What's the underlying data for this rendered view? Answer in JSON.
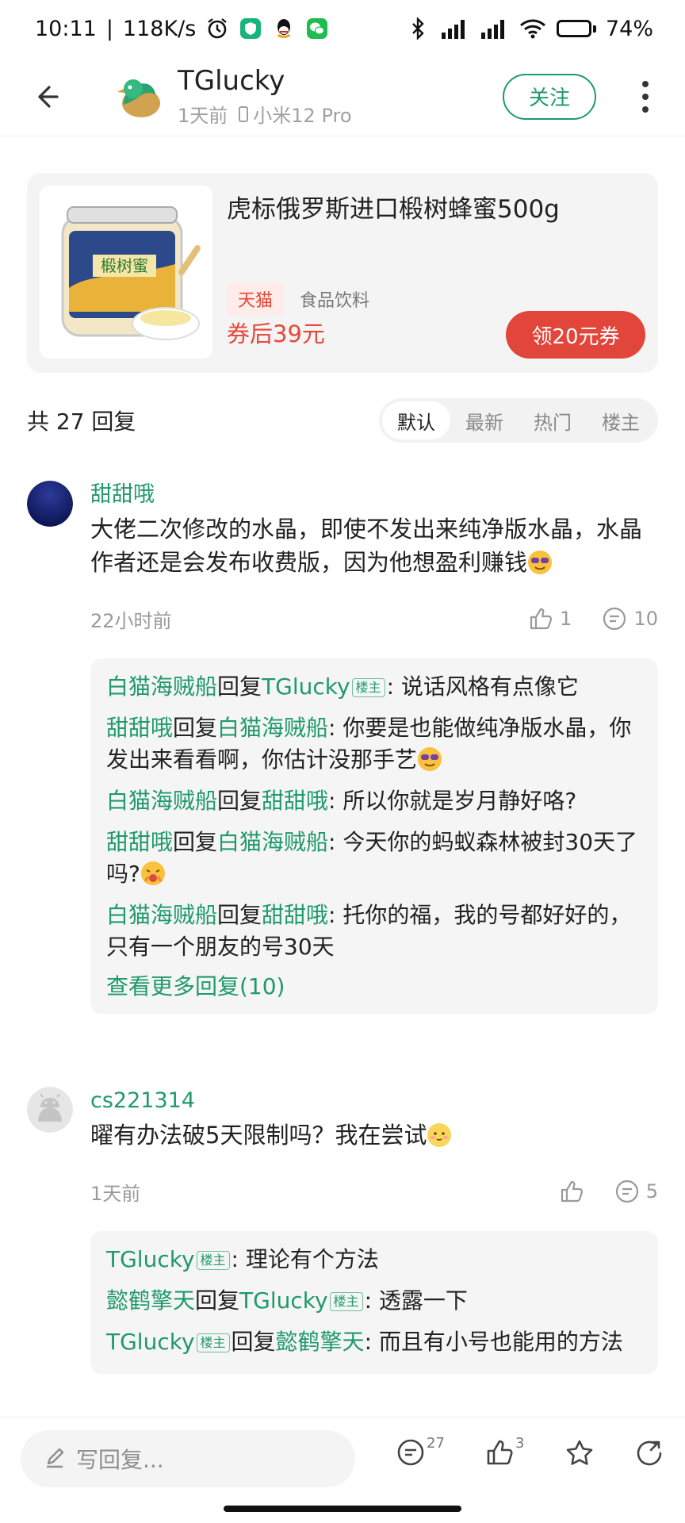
{
  "status_bar": {
    "time": "10:11",
    "network_speed": "118K/s",
    "battery": "74%",
    "battery_level": 0.74
  },
  "header": {
    "title": "TGlucky",
    "time_ago": "1天前",
    "device": "小米12 Pro",
    "follow_label": "关注"
  },
  "product": {
    "title": "虎标俄罗斯进口椴树蜂蜜500g",
    "store_tag": "天猫",
    "category": "食品饮料",
    "price": "券后39元",
    "coupon_label": "领20元券",
    "image_label": "椴树蜜"
  },
  "replies": {
    "count_label": "共 27 回复",
    "sort_tabs": [
      "默认",
      "最新",
      "热门",
      "楼主"
    ],
    "active_tab": "默认"
  },
  "comments": [
    {
      "author": "甜甜哦",
      "text": "大佬二次修改的水晶，即使不发出来纯净版水晶，水晶作者还是会发布收费版，因为他想盈利赚钱",
      "time": "22小时前",
      "likes": "1",
      "replies": "10",
      "sub_replies": [
        {
          "from": "白猫海贼船",
          "connector": "回复",
          "to": "TGlucky",
          "to_op": "楼主",
          "text": ": 说话风格有点像它"
        },
        {
          "from": "甜甜哦",
          "connector": "回复",
          "to": "白猫海贼船",
          "text": ": 你要是也能做纯净版水晶，你发出来看看啊，你估计没那手艺"
        },
        {
          "from": "白猫海贼船",
          "connector": "回复",
          "to": "甜甜哦",
          "text": ": 所以你就是岁月静好咯?"
        },
        {
          "from": "甜甜哦",
          "connector": "回复",
          "to": "白猫海贼船",
          "text": ": 今天你的蚂蚁森林被封30天了吗?"
        },
        {
          "from": "白猫海贼船",
          "connector": "回复",
          "to": "甜甜哦",
          "text": ": 托你的福，我的号都好好的，只有一个朋友的号30天"
        }
      ],
      "view_more": "查看更多回复(10)"
    },
    {
      "author": "cs221314",
      "text": "曜有办法破5天限制吗？我在尝试",
      "time": "1天前",
      "likes": "",
      "replies": "5",
      "sub_replies": [
        {
          "from": "TGlucky",
          "from_op": "楼主",
          "text": ": 理论有个方法"
        },
        {
          "from": "懿鹤擎天",
          "connector": "回复",
          "to": "TGlucky",
          "to_op": "楼主",
          "text": ": 透露一下"
        },
        {
          "from": "TGlucky",
          "from_op": "楼主",
          "connector": "回复",
          "to": "懿鹤擎天",
          "text": ": 而且有小号也能用的方法"
        }
      ]
    }
  ],
  "bottom_bar": {
    "input_placeholder": "写回复...",
    "comment_count": "27",
    "like_count": "3"
  },
  "colors": {
    "accent_green": "#1f9a6a",
    "coupon_red": "#e2453a",
    "price_red": "#e64839"
  },
  "icons": [
    "back-arrow-icon",
    "alarm-icon",
    "shield-icon",
    "qq-icon",
    "wechat-icon",
    "bluetooth-icon",
    "signal-icon",
    "wifi-icon",
    "battery-icon",
    "more-icon",
    "like-icon",
    "comment-icon",
    "pen-icon",
    "star-icon",
    "share-icon"
  ]
}
